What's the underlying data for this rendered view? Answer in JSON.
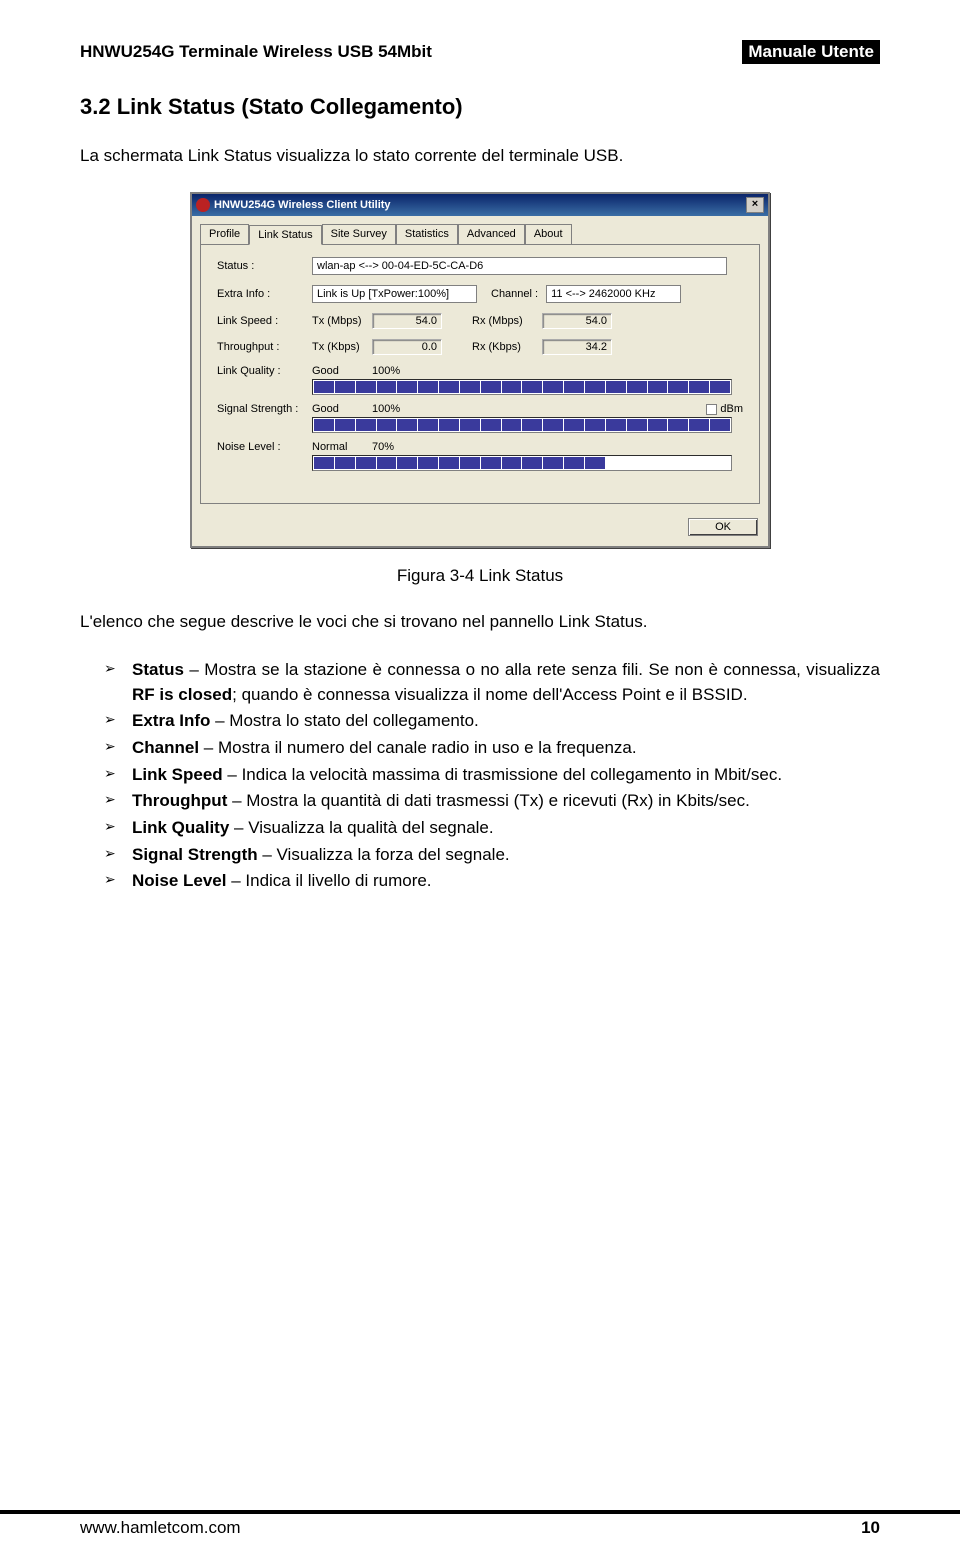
{
  "header": {
    "left": "HNWU254G Terminale Wireless USB 54Mbit",
    "right": "Manuale Utente"
  },
  "section": {
    "title": "3.2    Link Status (Stato Collegamento)",
    "intro": "La schermata Link Status visualizza lo stato corrente del terminale USB."
  },
  "window": {
    "title": "HNWU254G Wireless Client Utility",
    "close": "×",
    "tabs": [
      "Profile",
      "Link Status",
      "Site Survey",
      "Statistics",
      "Advanced",
      "About"
    ],
    "active_tab": 1,
    "status_label": "Status :",
    "status_value": "wlan-ap <--> 00-04-ED-5C-CA-D6",
    "extra_label": "Extra Info :",
    "extra_value": "Link is Up [TxPower:100%]",
    "channel_label": "Channel :",
    "channel_value": "11 <--> 2462000 KHz",
    "linkspeed_label": "Link Speed :",
    "tx_mbps_label": "Tx (Mbps)",
    "tx_mbps_value": "54.0",
    "rx_mbps_label": "Rx (Mbps)",
    "rx_mbps_value": "54.0",
    "throughput_label": "Throughput :",
    "tx_kbps_label": "Tx (Kbps)",
    "tx_kbps_value": "0.0",
    "rx_kbps_label": "Rx (Kbps)",
    "rx_kbps_value": "34.2",
    "linkquality_label": "Link Quality :",
    "lq_word": "Good",
    "lq_pct": "100%",
    "signal_label": "Signal Strength :",
    "sig_word": "Good",
    "sig_pct": "100%",
    "dbm_label": "dBm",
    "noise_label": "Noise Level :",
    "noise_word": "Normal",
    "noise_pct": "70%",
    "ok": "OK"
  },
  "caption": "Figura 3-4 Link Status",
  "after_caption": "L'elenco che segue descrive le voci che si trovano nel pannello Link Status.",
  "bullets": {
    "b1a": "Status",
    "b1b": " – Mostra se la stazione è connessa o no alla rete senza fili. Se non è connessa, visualizza ",
    "b1c": "RF is closed",
    "b1d": "; quando è connessa visualizza il nome dell'Access Point e il BSSID.",
    "b2a": "Extra Info",
    "b2b": " – Mostra lo stato del collegamento.",
    "b3a": "Channel",
    "b3b": " – Mostra il numero del canale radio in uso e la frequenza.",
    "b4a": "Link Speed",
    "b4b": " – Indica la velocità massima di trasmissione del collegamento in Mbit/sec.",
    "b5a": "Throughput",
    "b5b": " – Mostra la quantità di dati trasmessi (Tx) e ricevuti (Rx) in Kbits/sec.",
    "b6a": "Link Quality",
    "b6b": " – Visualizza la qualità del segnale.",
    "b7a": "Signal Strength",
    "b7b": " – Visualizza la forza del segnale.",
    "b8a": "Noise Level",
    "b8b": " – Indica il livello di rumore."
  },
  "footer": {
    "url": "www.hamletcom.com",
    "page": "10"
  }
}
